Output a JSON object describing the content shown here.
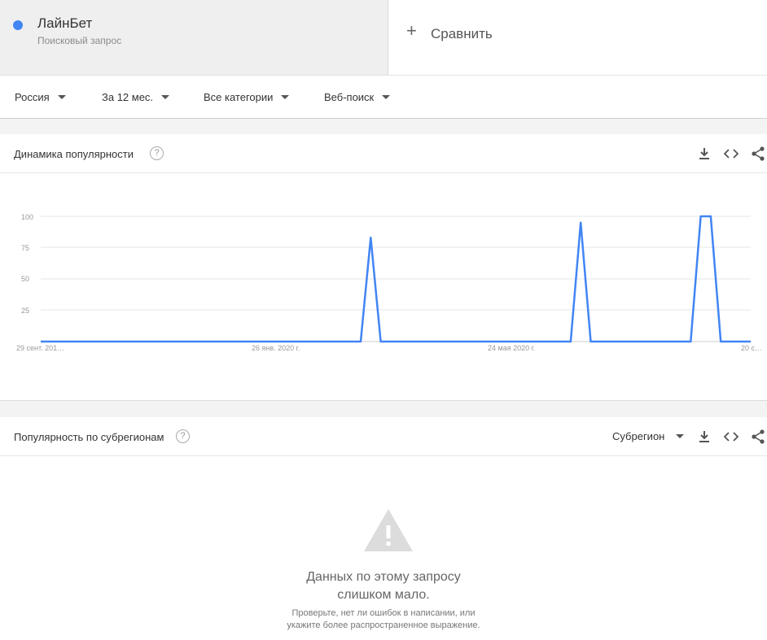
{
  "term": {
    "name": "ЛайнБет",
    "subtitle": "Поисковый запрос",
    "color": "#4285f4"
  },
  "compare": {
    "label": "Сравнить"
  },
  "filters": {
    "region": "Россия",
    "period": "За 12 мес.",
    "category": "Все категории",
    "search_type": "Веб-поиск"
  },
  "interest": {
    "title": "Динамика популярности",
    "help": "?"
  },
  "chart_data": {
    "type": "line",
    "series": [
      {
        "color": "#4285f4",
        "values": [
          0,
          0,
          0,
          0,
          0,
          0,
          0,
          0,
          0,
          0,
          0,
          0,
          0,
          0,
          0,
          0,
          0,
          0,
          0,
          0,
          0,
          0,
          0,
          0,
          0,
          0,
          0,
          0,
          0,
          0,
          0,
          0,
          0,
          83,
          0,
          0,
          0,
          0,
          0,
          0,
          0,
          0,
          0,
          0,
          0,
          0,
          0,
          0,
          0,
          0,
          0,
          0,
          0,
          0,
          95,
          0,
          0,
          0,
          0,
          0,
          0,
          0,
          0,
          0,
          0,
          0,
          100,
          100,
          0,
          0,
          0,
          0
        ]
      }
    ],
    "yticks": [
      "100",
      "75",
      "50",
      "25"
    ],
    "xlabels": [
      "29 сент. 201…",
      "26 янв. 2020 г.",
      "24 мая 2020 г.",
      "20 с…"
    ],
    "ylim": [
      0,
      100
    ],
    "grid": true
  },
  "subregions": {
    "title": "Популярность по субрегионам",
    "help": "?",
    "dropdown": "Субрегион",
    "empty_line1": "Данных по этому запросу",
    "empty_line2": "слишком мало.",
    "hint_line1": "Проверьте, нет ли ошибок в написании, или",
    "hint_line2": "укажите более распространенное выражение."
  }
}
